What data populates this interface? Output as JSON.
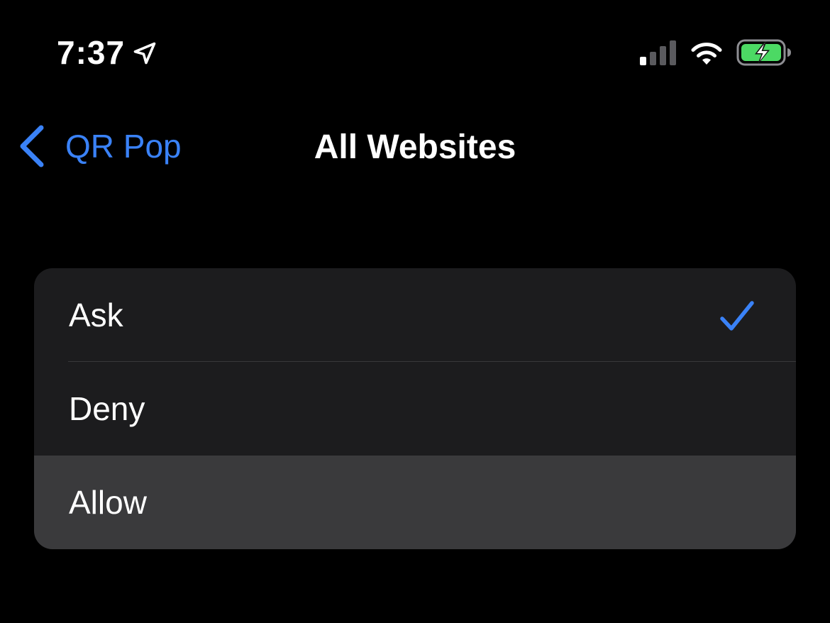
{
  "status_bar": {
    "time": "7:37",
    "icons": [
      "location-arrow-icon",
      "cellular-signal-icon",
      "wifi-icon",
      "battery-charging-icon"
    ]
  },
  "nav": {
    "back_label": "QR Pop",
    "title": "All Websites"
  },
  "options": [
    {
      "label": "Ask",
      "selected": true
    },
    {
      "label": "Deny",
      "selected": false
    },
    {
      "label": "Allow",
      "selected": false,
      "highlighted": true
    }
  ],
  "colors": {
    "background": "#000000",
    "group_background": "#1c1c1e",
    "highlight_background": "#3a3a3c",
    "accent": "#3a82f7",
    "battery_green": "#4cd964"
  }
}
